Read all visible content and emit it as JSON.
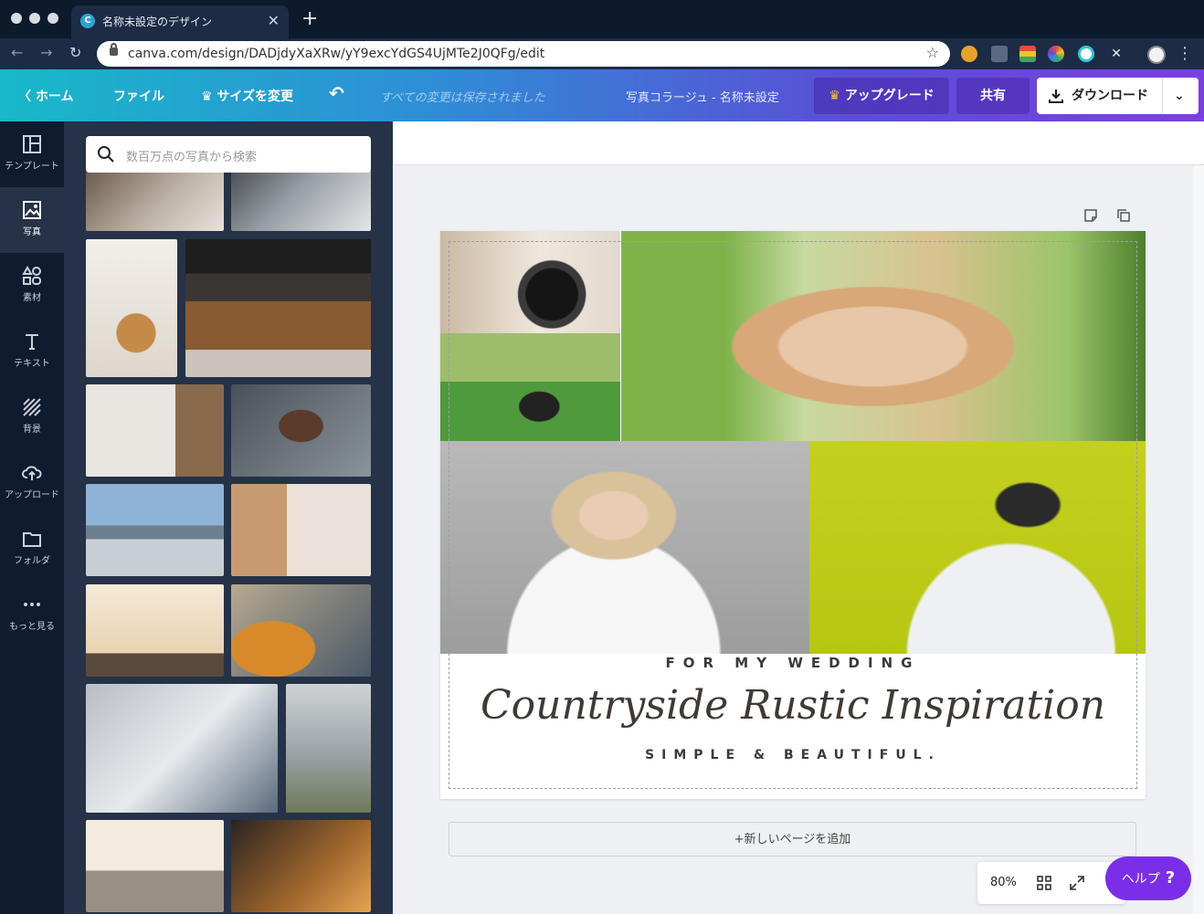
{
  "browser": {
    "tab_title": "名称未設定のデザイン",
    "tab_favicon": "C",
    "close_glyph": "✕",
    "new_tab_glyph": "+",
    "url": "canva.com/design/DADjdyXaXRw/yY9excYdGS4UjMTe2J0QFg/edit",
    "star_glyph": "☆",
    "menu_glyph": "⋮",
    "back_glyph": "←",
    "forward_glyph": "→",
    "reload_glyph": "↻"
  },
  "topbar": {
    "home": "ホーム",
    "file": "ファイル",
    "resize": "サイズを変更",
    "saved_status": "すべての変更は保存されました",
    "design_title": "写真コラージュ - 名称未設定",
    "upgrade": "アップグレード",
    "share": "共有",
    "download": "ダウンロード",
    "chevron_left": "〈",
    "undo_glyph": "↶",
    "crown_glyph": "♛",
    "chevron_down": "⌄"
  },
  "rail": {
    "items": [
      {
        "label": "テンプレート"
      },
      {
        "label": "写真"
      },
      {
        "label": "素材"
      },
      {
        "label": "テキスト"
      },
      {
        "label": "背景"
      },
      {
        "label": "アップロード"
      },
      {
        "label": "フォルダ"
      },
      {
        "label": "もっと見る"
      }
    ]
  },
  "panel": {
    "search_placeholder": "数百万点の写真から検索",
    "collapse_glyph": "‹"
  },
  "page": {
    "kicker": "FOR MY WEDDING",
    "title": "Countryside Rustic Inspiration",
    "subtitle": "SIMPLE & BEAUTIFUL."
  },
  "editor": {
    "add_page": "+新しいページを追加",
    "zoom": "80%",
    "help": "ヘルプ",
    "help_glyph": "?"
  },
  "colors": {
    "brand_gradient_start": "#18b8c9",
    "brand_gradient_end": "#7a3fe0",
    "help_purple": "#7a2ee8",
    "rail_bg": "#0f1b2e",
    "panel_bg": "#253247"
  }
}
